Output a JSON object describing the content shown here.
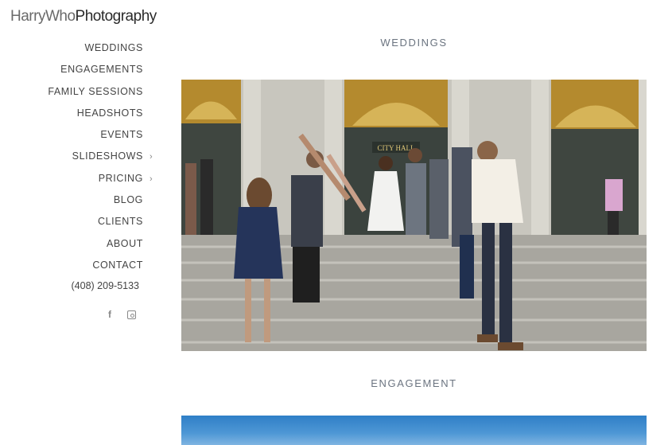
{
  "logo": {
    "part1": "HarryWho",
    "part2": "Photography"
  },
  "nav": {
    "items": [
      {
        "label": "WEDDINGS"
      },
      {
        "label": "ENGAGEMENTS"
      },
      {
        "label": "FAMILY SESSIONS"
      },
      {
        "label": "HEADSHOTS"
      },
      {
        "label": "EVENTS"
      },
      {
        "label": "SLIDESHOWS",
        "chevron": "›"
      },
      {
        "label": "PRICING",
        "chevron": "›"
      },
      {
        "label": "BLOG"
      },
      {
        "label": "CLIENTS"
      },
      {
        "label": "ABOUT"
      },
      {
        "label": "CONTACT"
      }
    ]
  },
  "phone": "(408) 209-5133",
  "social": {
    "facebook": "f",
    "instagram": "instagram-icon"
  },
  "sections": {
    "weddings_title": "WEDDINGS",
    "weddings_sign": "CITY HALL",
    "engagement_title": "ENGAGEMENT"
  },
  "colors": {
    "accent": "#6b7480",
    "nav_text": "#444444",
    "stone": "#bdbbb3",
    "gold": "#c9a24a",
    "sky": "#4e97d5"
  }
}
